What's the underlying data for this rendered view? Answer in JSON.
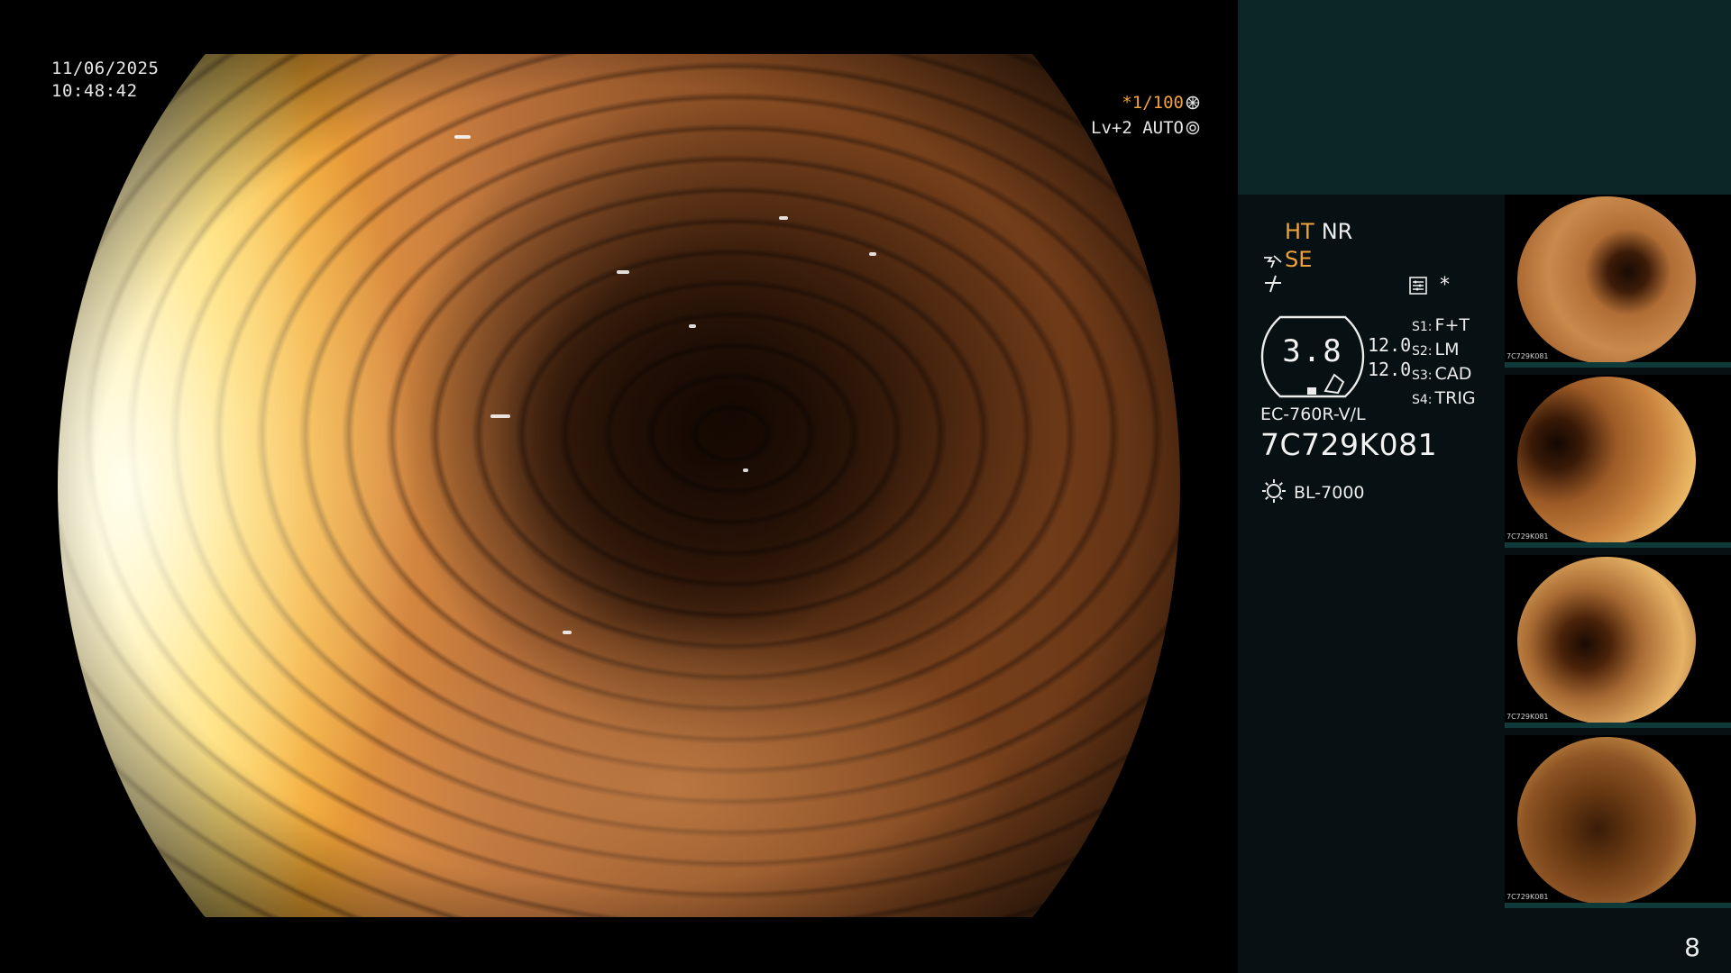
{
  "overlay": {
    "date": "11/06/2025",
    "time": "10:48:42",
    "shutter": "*1/100",
    "iris_level": "Lv+2 AUTO"
  },
  "info": {
    "mode_ht": "HT",
    "mode_nr": "NR",
    "se_label": "SE",
    "star": "*",
    "gauge_value": "3.8",
    "gain_values": [
      "12.0",
      "12.0"
    ],
    "switches": [
      {
        "key": "S1:",
        "value": "F+T"
      },
      {
        "key": "S2:",
        "value": "LM"
      },
      {
        "key": "S3:",
        "value": "CAD"
      },
      {
        "key": "S4:",
        "value": "TRIG"
      }
    ],
    "scope_model": "EC-760R-V/L",
    "scope_serial": "7C729K081",
    "light_source": "BL-7000",
    "page_number": "8"
  },
  "thumbnails": [
    {
      "label": "7C729K081"
    },
    {
      "label": "7C729K081"
    },
    {
      "label": "7C729K081"
    },
    {
      "label": "7C729K081"
    }
  ],
  "colors": {
    "accent_orange": "#f0a23a",
    "panel_bg": "#071012",
    "panel_top": "#0c2526"
  }
}
